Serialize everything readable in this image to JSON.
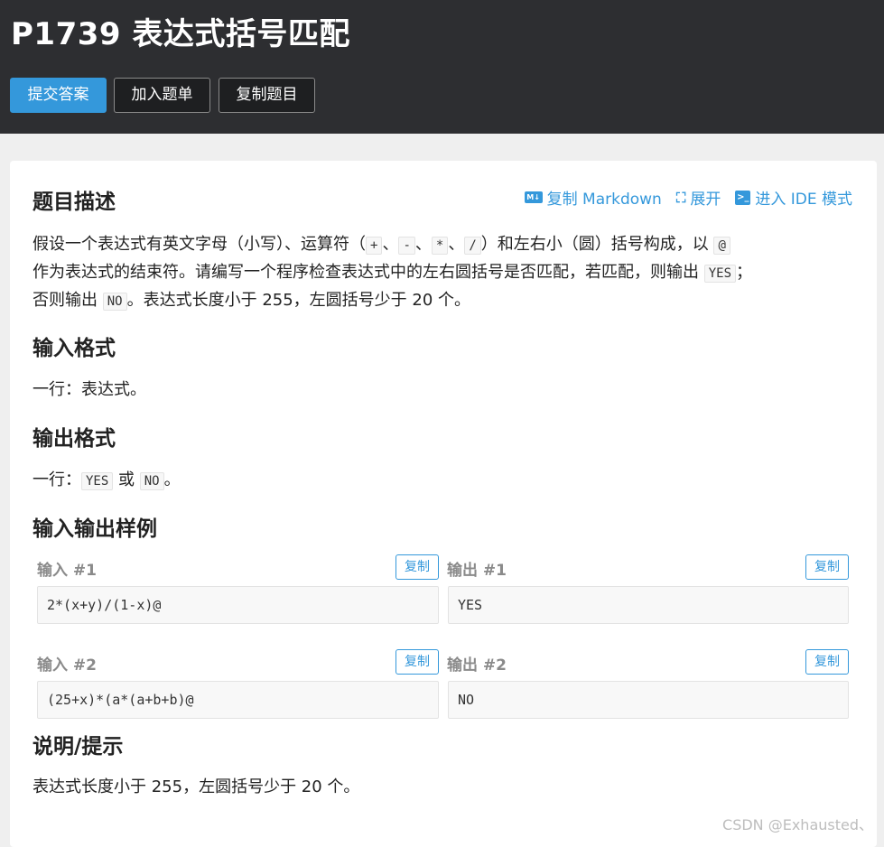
{
  "problem": {
    "title": "P1739 表达式括号匹配"
  },
  "toolbar": {
    "submit_label": "提交答案",
    "add_list_label": "加入题单",
    "copy_problem_label": "复制题目"
  },
  "tools": {
    "copy_markdown": "复制 Markdown",
    "expand": "展开",
    "ide_mode": "进入 IDE 模式"
  },
  "sections": {
    "description_title": "题目描述",
    "desc": {
      "line1_a": "假设一个表达式有英文字母（小写）、运算符（",
      "op_plus": "+",
      "sep": "、",
      "op_minus": "-",
      "op_mul": "*",
      "op_div": "/",
      "line1_b": "）和左右小（圆）括号构成，以 ",
      "at": "@",
      "line2_a": "作为表达式的结束符。请编写一个程序检查表达式中的左右圆括号是否匹配，若匹配，则输出 ",
      "yes": "YES",
      "line2_b": "；",
      "line3_a": "否则输出 ",
      "no": "NO",
      "line3_b": "。表达式长度小于 255，左圆括号少于 20 个。"
    },
    "input_title": "输入格式",
    "input_text": "一行：表达式。",
    "output_title": "输出格式",
    "output_a": "一行：",
    "output_yes": "YES",
    "output_or": " 或 ",
    "output_no": "NO",
    "output_end": "。",
    "samples_title": "输入输出样例",
    "hint_title": "说明/提示",
    "hint_text": "表达式长度小于 255，左圆括号少于 20 个。"
  },
  "samples": [
    {
      "in_label": "输入 #1",
      "out_label": "输出 #1",
      "input": "2*(x+y)/(1-x)@",
      "output": "YES"
    },
    {
      "in_label": "输入 #2",
      "out_label": "输出 #2",
      "input": "(25+x)*(a*(a+b+b)@",
      "output": "NO"
    }
  ],
  "copy_label": "复制",
  "watermark": "CSDN @Exhausted、",
  "colors": {
    "header_bg": "#2d2e31",
    "accent": "#3498db",
    "page_bg": "#efefef"
  }
}
